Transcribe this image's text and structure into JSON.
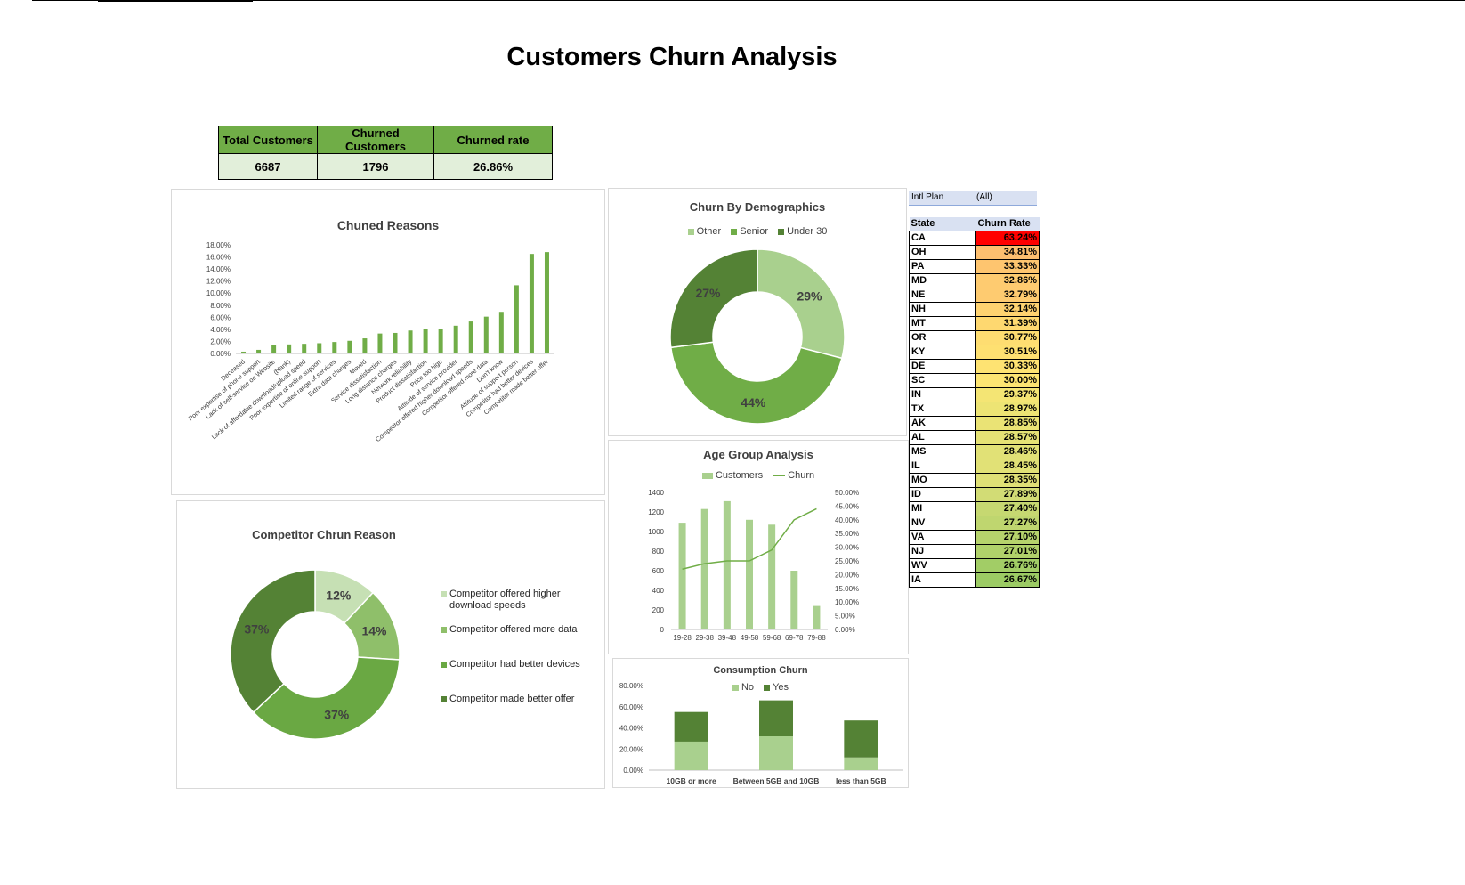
{
  "title": "Customers Churn Analysis",
  "kpi": {
    "headers": [
      "Total Customers",
      "Churned Customers",
      "Churned rate"
    ],
    "values": [
      "6687",
      "1796",
      "26.86%"
    ]
  },
  "colors": {
    "light": "#a9d08e",
    "mid": "#70ad47",
    "dark": "#548235",
    "pale": "#c6e0b4"
  },
  "chart_data": [
    {
      "type": "bar",
      "title": "Chuned Reasons",
      "categories": [
        "Deceased",
        "Poor expertise of phone support",
        "Lack of self-service on Website",
        "(blank)",
        "Lack of affordable download/upload speed",
        "Poor expertise of online support",
        "Limited range of services",
        "Extra data charges",
        "Moved",
        "Service dissatisfaction",
        "Long distance charges",
        "Network reliability",
        "Product dissatisfaction",
        "Price too high",
        "Attitude of service provider",
        "Competitor offered higher download speeds",
        "Competitor offered more data",
        "Don't know",
        "Attitude of support person",
        "Competitor had better devices",
        "Competitor made better offer"
      ],
      "values": [
        0.3,
        0.6,
        1.4,
        1.5,
        1.6,
        1.7,
        1.9,
        2.1,
        2.5,
        3.3,
        3.4,
        3.8,
        4.0,
        4.1,
        4.6,
        5.3,
        6.1,
        6.9,
        11.3,
        16.5,
        16.8
      ],
      "yticks": [
        "0.00%",
        "2.00%",
        "4.00%",
        "6.00%",
        "8.00%",
        "10.00%",
        "12.00%",
        "14.00%",
        "16.00%",
        "18.00%"
      ],
      "ylim": [
        0,
        18
      ]
    },
    {
      "type": "pie",
      "title": "Churn By Demographics",
      "labels": [
        "Other",
        "Senior",
        "Under 30"
      ],
      "values": [
        29,
        44,
        27
      ],
      "value_labels": [
        "29%",
        "44%",
        "27%"
      ]
    },
    {
      "type": "pie",
      "title": "Competitor Chrun Reason",
      "labels": [
        "Competitor offered higher download speeds",
        "Competitor offered more data",
        "Competitor had better devices",
        "Competitor made better offer"
      ],
      "values": [
        12,
        14,
        37,
        37
      ],
      "value_labels": [
        "12%",
        "14%",
        "37%",
        "37%"
      ]
    },
    {
      "type": "bar",
      "title": "Age Group Analysis",
      "categories": [
        "19-28",
        "29-38",
        "39-48",
        "49-58",
        "59-68",
        "69-78",
        "79-88"
      ],
      "series": [
        {
          "name": "Customers",
          "values": [
            1090,
            1230,
            1310,
            1120,
            1070,
            600,
            240
          ]
        },
        {
          "name": "Churn",
          "values": [
            22,
            24,
            25,
            25,
            29,
            40,
            44
          ]
        }
      ],
      "yticks_left": [
        "0",
        "200",
        "400",
        "600",
        "800",
        "1000",
        "1200",
        "1400"
      ],
      "yticks_right": [
        "0.00%",
        "5.00%",
        "10.00%",
        "15.00%",
        "20.00%",
        "25.00%",
        "30.00%",
        "35.00%",
        "40.00%",
        "45.00%",
        "50.00%"
      ],
      "ylim_left": [
        0,
        1400
      ],
      "ylim_right": [
        0,
        50
      ]
    },
    {
      "type": "bar",
      "title": "Consumption Churn",
      "categories": [
        "10GB or more",
        "Between 5GB and 10GB",
        "less than 5GB"
      ],
      "series": [
        {
          "name": "No",
          "values": [
            27,
            32,
            12
          ]
        },
        {
          "name": "Yes",
          "values": [
            28,
            34,
            35
          ]
        }
      ],
      "yticks": [
        "0.00%",
        "20.00%",
        "40.00%",
        "60.00%",
        "80.00%"
      ],
      "ylim": [
        0,
        80
      ]
    }
  ],
  "filter": {
    "label": "Intl Plan",
    "value": "(All)"
  },
  "states": {
    "headers": [
      "State",
      "Churn Rate"
    ],
    "rows": [
      [
        "CA",
        "63.24%",
        "#ff0000"
      ],
      [
        "OH",
        "34.81%",
        "#fdbf6f"
      ],
      [
        "PA",
        "33.33%",
        "#fec56f"
      ],
      [
        "MD",
        "32.86%",
        "#fecb70"
      ],
      [
        "NE",
        "32.79%",
        "#fecb70"
      ],
      [
        "NH",
        "32.14%",
        "#fed270"
      ],
      [
        "MT",
        "31.39%",
        "#fed870"
      ],
      [
        "OR",
        "30.77%",
        "#fedd71"
      ],
      [
        "KY",
        "30.51%",
        "#fee071"
      ],
      [
        "DE",
        "30.33%",
        "#fee372"
      ],
      [
        "SC",
        "30.00%",
        "#fde572"
      ],
      [
        "IN",
        "29.37%",
        "#f4e574"
      ],
      [
        "TX",
        "28.97%",
        "#ede474"
      ],
      [
        "AK",
        "28.85%",
        "#eae375"
      ],
      [
        "AL",
        "28.57%",
        "#e5e275"
      ],
      [
        "MS",
        "28.46%",
        "#e1e176"
      ],
      [
        "IL",
        "28.45%",
        "#e1e176"
      ],
      [
        "MO",
        "28.35%",
        "#dfe076"
      ],
      [
        "ID",
        "27.89%",
        "#d2dc75"
      ],
      [
        "MI",
        "27.40%",
        "#c6d871"
      ],
      [
        "NV",
        "27.27%",
        "#bfd66f"
      ],
      [
        "VA",
        "27.10%",
        "#b6d36c"
      ],
      [
        "NJ",
        "27.01%",
        "#b0d16a"
      ],
      [
        "WV",
        "26.76%",
        "#a2cd66"
      ],
      [
        "IA",
        "26.67%",
        "#9ccb64"
      ]
    ]
  }
}
